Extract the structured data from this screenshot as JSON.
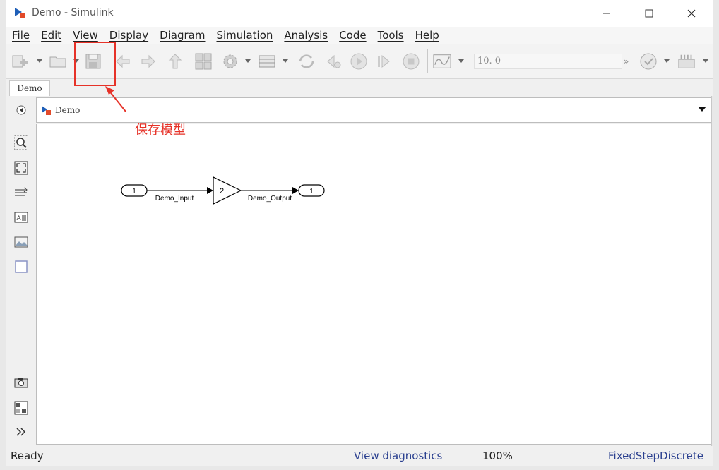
{
  "window": {
    "title": "Demo - Simulink"
  },
  "menu": [
    "File",
    "Edit",
    "View",
    "Display",
    "Diagram",
    "Simulation",
    "Analysis",
    "Code",
    "Tools",
    "Help"
  ],
  "toolbar": {
    "stop_time": "10. 0"
  },
  "tab": {
    "label": "Demo"
  },
  "address": {
    "path": "Demo"
  },
  "diagram": {
    "inport": {
      "number": "1",
      "signal": "Demo_Input"
    },
    "gain": {
      "value": "2"
    },
    "outport": {
      "number": "1",
      "signal": "Demo_Output"
    }
  },
  "status": {
    "ready": "Ready",
    "diagnostics": "View diagnostics",
    "zoom": "100%",
    "solver": "FixedStepDiscrete"
  },
  "annotation": {
    "label": "保存模型"
  },
  "colors": {
    "annotation": "#e63228",
    "link": "#2a3f8f",
    "simulink_blue": "#1f5fb8"
  }
}
